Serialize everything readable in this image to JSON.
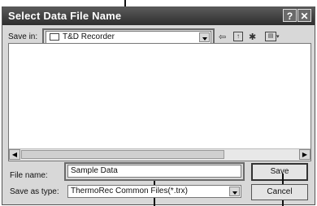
{
  "window": {
    "title": "Select Data File Name"
  },
  "titlebar": {
    "help_label": "?",
    "close_label": "✕"
  },
  "save_in": {
    "label": "Save in:",
    "value": "T&D Recorder"
  },
  "toolbar": {
    "back_icon": "back-arrow-icon",
    "up_icon": "up-folder-icon",
    "new_folder_icon": "new-folder-icon",
    "views_icon": "views-menu-icon"
  },
  "file_name": {
    "label": "File name:",
    "value": "Sample Data"
  },
  "save_as_type": {
    "label": "Save as type:",
    "value": "ThermoRec Common Files(*.trx)"
  },
  "buttons": {
    "save": "Save",
    "cancel": "Cancel"
  }
}
